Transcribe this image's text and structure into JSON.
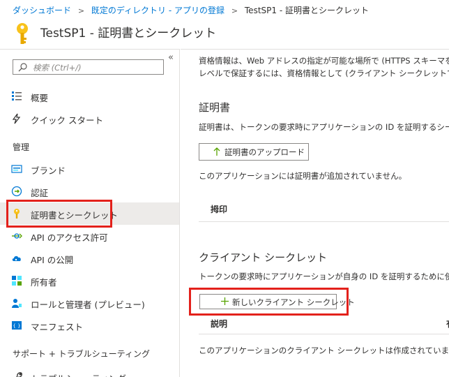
{
  "breadcrumb": {
    "items": [
      "ダッシュボード",
      "既定のディレクトリ - アプリの登録",
      "TestSP1 - 証明書とシークレット"
    ]
  },
  "page": {
    "title": "TestSP1 - 証明書とシークレット"
  },
  "sidebar": {
    "search_placeholder": "検索 (Ctrl+/)",
    "collapse": "«",
    "top_items": [
      {
        "label": "概要",
        "icon": "overview-icon"
      },
      {
        "label": "クイック スタート",
        "icon": "lightning-icon"
      }
    ],
    "section_manage": "管理",
    "manage_items": [
      {
        "label": "ブランド",
        "icon": "branding-icon"
      },
      {
        "label": "認証",
        "icon": "authentication-icon"
      },
      {
        "label": "証明書とシークレット",
        "icon": "key-icon",
        "active": true
      },
      {
        "label": "API のアクセス許可",
        "icon": "api-permissions-icon"
      },
      {
        "label": "API の公開",
        "icon": "cloud-icon"
      },
      {
        "label": "所有者",
        "icon": "owners-icon"
      },
      {
        "label": "ロールと管理者 (プレビュー)",
        "icon": "roles-icon"
      },
      {
        "label": "マニフェスト",
        "icon": "manifest-icon"
      }
    ],
    "section_support": "サポート + トラブルシューティング",
    "support_items": [
      {
        "label": "トラブルシューティング",
        "icon": "troubleshoot-icon"
      }
    ]
  },
  "content": {
    "intro_line1": "資格情報は、Web アドレスの指定が可能な場所で (HTTPS スキーマを",
    "intro_line2": "レベルで保証するには、資格情報として (クライアント シークレットではなく",
    "certificates": {
      "title": "証明書",
      "description": "証明書は、トークンの要求時にアプリケーションの ID を証明するシークレ",
      "upload_button": "証明書のアップロード",
      "empty_message": "このアプリケーションには証明書が追加されていません。",
      "column_thumbprint": "拇印"
    },
    "secrets": {
      "title": "クライアント シークレット",
      "description": "トークンの要求時にアプリケーションが自身の ID を証明するために使用す",
      "new_button": "新しいクライアント シークレット",
      "column_description": "説明",
      "column_expires": "有",
      "empty_message": "このアプリケーションのクライアント シークレットは作成されていません。"
    }
  },
  "colors": {
    "link": "#0078d4",
    "highlight": "#e3211b",
    "active_bg": "#edebe9",
    "upload_arrow": "#57a300"
  }
}
